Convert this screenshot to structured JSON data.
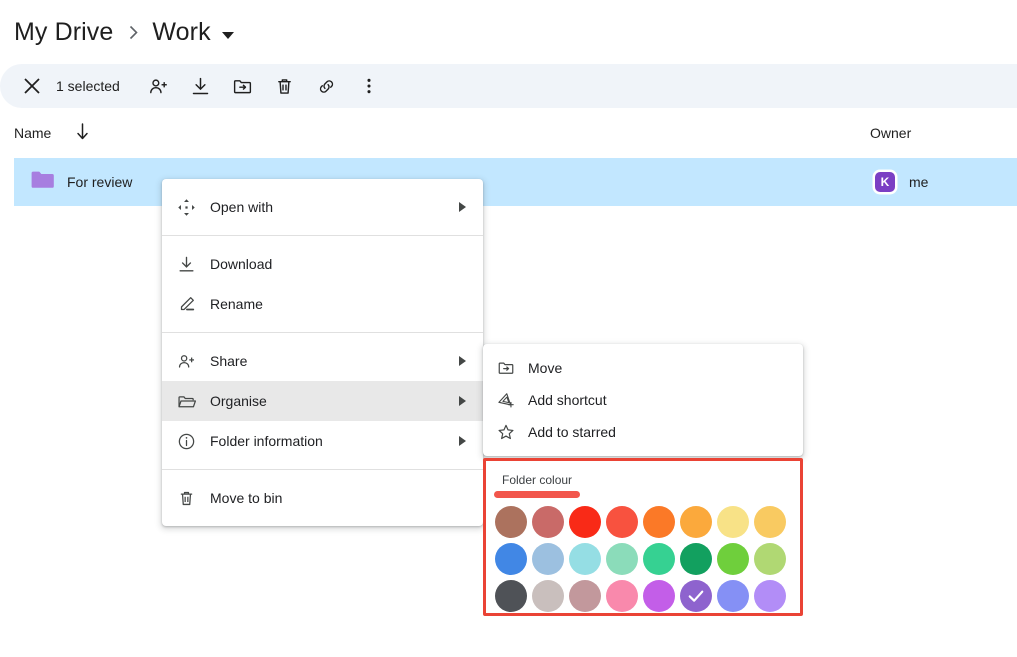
{
  "breadcrumb": {
    "root_label": "My Drive",
    "separator_icon": "chevron-right-icon",
    "current_label": "Work",
    "caret_icon": "caret-down-icon"
  },
  "selection_toolbar": {
    "close_icon": "close-icon",
    "count_label": "1 selected",
    "actions": [
      {
        "name": "share-button",
        "icon": "person-add-icon",
        "label": "Share"
      },
      {
        "name": "download-button",
        "icon": "download-icon",
        "label": "Download"
      },
      {
        "name": "move-button",
        "icon": "folder-move-icon",
        "label": "Move"
      },
      {
        "name": "delete-button",
        "icon": "trash-icon",
        "label": "Move to bin"
      },
      {
        "name": "copy-link-button",
        "icon": "link-icon",
        "label": "Copy link"
      },
      {
        "name": "more-options-button",
        "icon": "more-vert-icon",
        "label": "More actions"
      }
    ]
  },
  "columns": {
    "name_header": "Name",
    "sort_icon": "arrow-down-icon",
    "owner_header": "Owner"
  },
  "file_row": {
    "folder_icon": "folder-icon",
    "folder_icon_color": "#a77ee0",
    "name": "For review",
    "owner_avatar_letter": "K",
    "owner_avatar_color": "#7b3fc4",
    "owner_label": "me",
    "row_highlight_color": "#c2e7ff"
  },
  "context_menu": {
    "groups": [
      {
        "items": [
          {
            "label": "Open with",
            "icon": "open-with-icon",
            "submenu": true,
            "active": false
          }
        ]
      },
      {
        "items": [
          {
            "label": "Download",
            "icon": "download-icon",
            "submenu": false,
            "active": false
          },
          {
            "label": "Rename",
            "icon": "pencil-icon",
            "submenu": false,
            "active": false
          }
        ]
      },
      {
        "items": [
          {
            "label": "Share",
            "icon": "person-add-icon",
            "submenu": true,
            "active": false
          },
          {
            "label": "Organise",
            "icon": "folder-open-icon",
            "submenu": true,
            "active": true
          },
          {
            "label": "Folder information",
            "icon": "info-icon",
            "submenu": true,
            "active": false
          }
        ]
      },
      {
        "items": [
          {
            "label": "Move to bin",
            "icon": "trash-icon",
            "submenu": false,
            "active": false
          }
        ]
      }
    ]
  },
  "submenu": {
    "items": [
      {
        "label": "Move",
        "icon": "folder-move-icon"
      },
      {
        "label": "Add shortcut",
        "icon": "add-shortcut-icon"
      },
      {
        "label": "Add to starred",
        "icon": "star-outline-icon"
      }
    ]
  },
  "colour_panel": {
    "title": "Folder colour",
    "highlight_border_color": "#ea4335",
    "underline_color": "#f2564c",
    "selected_index": 21,
    "check_icon": "check-icon",
    "swatches": [
      {
        "name": "brown",
        "hex": "#ac725e"
      },
      {
        "name": "dusty-rose",
        "hex": "#c96a68"
      },
      {
        "name": "red",
        "hex": "#f92a17"
      },
      {
        "name": "coral-red",
        "hex": "#f8523f"
      },
      {
        "name": "orange",
        "hex": "#fb7927"
      },
      {
        "name": "light-orange",
        "hex": "#fba93c"
      },
      {
        "name": "pale-yellow",
        "hex": "#f8e287"
      },
      {
        "name": "golden-yellow",
        "hex": "#f9ca61"
      },
      {
        "name": "blue",
        "hex": "#4187e5"
      },
      {
        "name": "light-blue",
        "hex": "#9cc0e0"
      },
      {
        "name": "pale-cyan",
        "hex": "#95dee4"
      },
      {
        "name": "mint",
        "hex": "#8bdcba"
      },
      {
        "name": "green",
        "hex": "#36d192"
      },
      {
        "name": "dark-green",
        "hex": "#12a05f"
      },
      {
        "name": "light-green",
        "hex": "#6fcf3c"
      },
      {
        "name": "yellow-green",
        "hex": "#b0d873"
      },
      {
        "name": "dark-grey",
        "hex": "#4f5257"
      },
      {
        "name": "light-grey",
        "hex": "#c9bfbd"
      },
      {
        "name": "rose-grey",
        "hex": "#c2989c"
      },
      {
        "name": "pink",
        "hex": "#f989ac"
      },
      {
        "name": "orchid",
        "hex": "#c35ee8"
      },
      {
        "name": "purple",
        "hex": "#8e63ce"
      },
      {
        "name": "periwinkle",
        "hex": "#8590f5"
      },
      {
        "name": "light-purple",
        "hex": "#b28df7"
      }
    ]
  }
}
